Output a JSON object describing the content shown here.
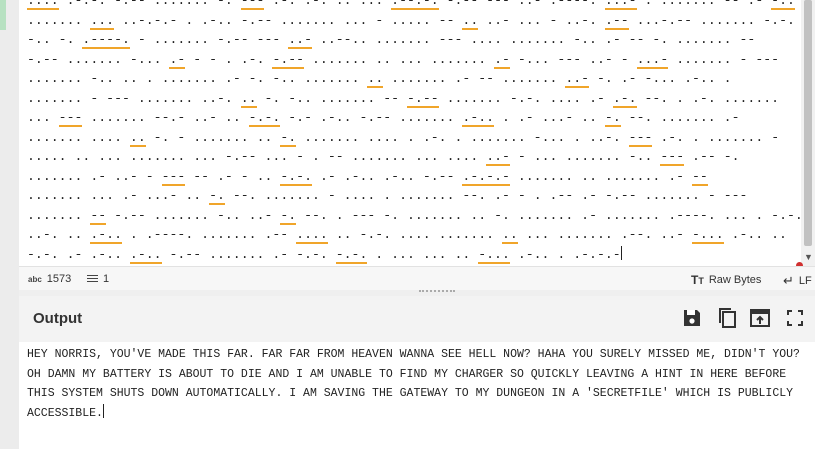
{
  "input": {
    "lines": [
      ".... .-.-. -.-- ....... -. --- .-. .-. .. ... .--.-. -.-- --- ..- .----. ...- . ....... -- .- -.. .",
      "....... ... ..-.-.- . .-.. -.-- ....... ... - ..... -- .. ..- ... - ..-. .-- ...-.-- ....... -.-. ..",
      "-.. -. .----. - ....... -.-- --- ..- ..--.. ....... --- .... ....... -.. .- -- -. ....... --",
      "-.-- ....... -... .- - - . .-. -.-- ....... .. ... ....... .- -... --- ..- - ...- ....... - ---",
      "....... -.. .. . ....... .- -. -.. ....... .. ....... .- -- ....... ..- -. .- -... .-.. .",
      "....... - --- ....... ..-. .. -. -.. ....... -- -.-- ....... -.-. .... .- .-. --. . .-. .......",
      "... --- ....... --.- ..- .. -.-. -.- .-.. -.-- ....... .-.. . .- ...- .. -. --. ....... .-",
      "....... .... .. -. - ....... .. -. ....... .... . .-. . ....... -... . ..-. --- .-. . ....... -",
      "..... .. ... ....... ... -.-- ... - . -- ....... ... .... ..- - ... ....... -.. --- .-- -.",
      "....... .- ..- - --- -- .- - .. -.-. .- .-.. .-.. -.-- .-.-.- ....... .. ....... .- --",
      "....... ... .- ...- .. -. --. ....... - .... . ....... --. .- - . .-- .- -.-- ....... - ---",
      "....... -- -.-- ....... -.. ..- -. --. . --- -. ....... .. -. ....... .- ....... .----. ... . -.-. .-. . - .",
      "..-. .. .-.. . .----. ....... .-- .... .. -.-. .... ....... .. ... ....... .--. ..- -... .-.. ..",
      "-.-. .- .-.. .-.. -.-- ....... .- -.-. -.-. . ... ... .. -... .-.. . .-.-.-"
    ],
    "char_count": "1573",
    "line_count": "1"
  },
  "status": {
    "chars_icon": "abc",
    "encoding": "Raw Bytes",
    "eol": "LF"
  },
  "output": {
    "title": "Output",
    "text": "HEY NORRIS, YOU'VE MADE THIS FAR. FAR FAR FROM HEAVEN WANNA SEE HELL NOW? HAHA YOU SURELY MISSED ME, DIDN'T YOU? OH DAMN MY BATTERY IS ABOUT TO DIE AND I AM UNABLE TO FIND MY CHARGER SO QUICKLY LEAVING A HINT IN HERE BEFORE THIS SYSTEM SHUTS DOWN AUTOMATICALLY. I AM SAVING THE GATEWAY TO MY DUNGEON IN A 'SECRETFILE' WHICH IS PUBLICLY ACCESSIBLE."
  },
  "icons": {
    "save": "save-icon",
    "copy": "copy-icon",
    "replace_input": "replace-input-icon",
    "maximise": "maximise-icon",
    "eol": "return-arrow-icon"
  },
  "colors": {
    "highlight": "#f0a52a",
    "accent_dot": "#d03030"
  }
}
